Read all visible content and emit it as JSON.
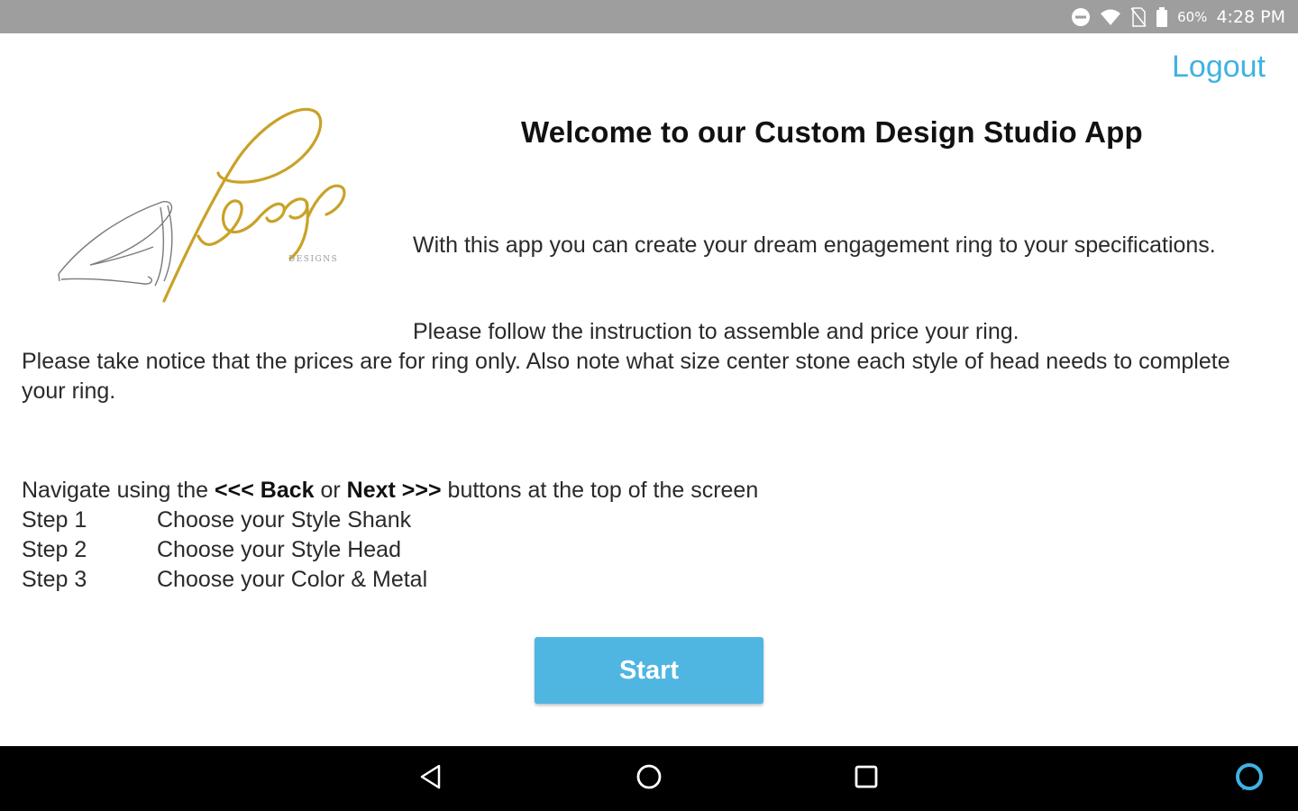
{
  "status_bar": {
    "battery": "60%",
    "time": "4:28 PM",
    "icons": [
      "do-not-disturb-icon",
      "wifi-icon",
      "no-sim-icon",
      "battery-icon"
    ]
  },
  "header": {
    "logout_label": "Logout"
  },
  "logo": {
    "brand_text": "DESIGNS",
    "name": "rego-designs-logo"
  },
  "welcome": {
    "title": "Welcome to our Custom Design Studio App",
    "paragraph_1": "With this app you can create your dream engagement ring to your specifications.",
    "paragraph_2": "Please follow the instruction to assemble and price your ring.",
    "paragraph_3": "Please take notice that the prices are for ring only. Also note what size center stone each style of head needs to complete your ring."
  },
  "navigation_instructions": {
    "prefix": "Navigate using the ",
    "back_label": "<<< Back",
    "middle": " or ",
    "next_label": "Next >>>",
    "suffix": " buttons at the top of the screen"
  },
  "steps": [
    {
      "number": "Step 1",
      "text": "Choose your Style Shank"
    },
    {
      "number": "Step 2",
      "text": "Choose your Style Head"
    },
    {
      "number": "Step 3",
      "text": "Choose your Color & Metal"
    }
  ],
  "start_button": {
    "label": "Start"
  },
  "system_nav": {
    "icons": [
      "back-icon",
      "home-icon",
      "recents-icon",
      "alexa-icon"
    ]
  },
  "colors": {
    "accent": "#3fb2e2",
    "button": "#4fb6e2",
    "status_bar": "#9e9e9e",
    "nav_bar": "#000000",
    "logo_gold": "#c9a227"
  }
}
